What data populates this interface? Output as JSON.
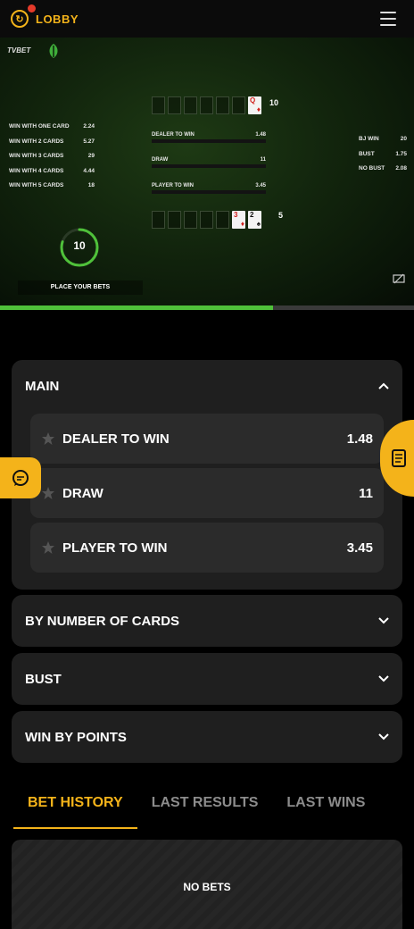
{
  "topbar": {
    "logo_glyph": "↻",
    "title": "LOBBY"
  },
  "video": {
    "brand": "TVBET",
    "dealer_score": "10",
    "player_score": "5",
    "dealer_cards": [
      {
        "rank": "Q",
        "suit": "♦",
        "color": "red"
      }
    ],
    "player_cards": [
      {
        "rank": "3",
        "suit": "♦",
        "color": "red"
      },
      {
        "rank": "2",
        "suit": "♠",
        "color": "black"
      }
    ],
    "left_odds": [
      {
        "label": "WIN WITH ONE CARD",
        "value": "2.24"
      },
      {
        "label": "WIN WITH 2 CARDS",
        "value": "5.27"
      },
      {
        "label": "WIN WITH 3 CARDS",
        "value": "29"
      },
      {
        "label": "WIN WITH 4 CARDS",
        "value": "4.44"
      },
      {
        "label": "WIN WITH 5 CARDS",
        "value": "18"
      }
    ],
    "mid_bets": [
      {
        "label": "DEALER TO WIN",
        "value": "1.48"
      },
      {
        "label": "DRAW",
        "value": "11"
      },
      {
        "label": "PLAYER TO WIN",
        "value": "3.45"
      }
    ],
    "right_odds": [
      {
        "label": "BJ WIN",
        "value": "20"
      },
      {
        "label": "BUST",
        "value": "1.75"
      },
      {
        "label": "NO BUST",
        "value": "2.08"
      }
    ],
    "timer": "10",
    "timer_fraction": 0.8,
    "place_bets": "PLACE YOUR BETS",
    "progress_fraction": 0.66
  },
  "main_section": {
    "title": "MAIN",
    "options": [
      {
        "label": "DEALER TO WIN",
        "odd": "1.48"
      },
      {
        "label": "DRAW",
        "odd": "11"
      },
      {
        "label": "PLAYER TO WIN",
        "odd": "3.45"
      }
    ]
  },
  "sections": [
    {
      "title": "BY NUMBER OF CARDS"
    },
    {
      "title": "BUST"
    },
    {
      "title": "WIN BY POINTS"
    }
  ],
  "tabs": [
    "BET HISTORY",
    "LAST RESULTS",
    "LAST WINS"
  ],
  "no_bets": "NO BETS",
  "colors": {
    "accent": "#f4b31a",
    "progress": "#4fc13a",
    "panel": "#1f1f1f",
    "option": "#2b2b2b"
  }
}
